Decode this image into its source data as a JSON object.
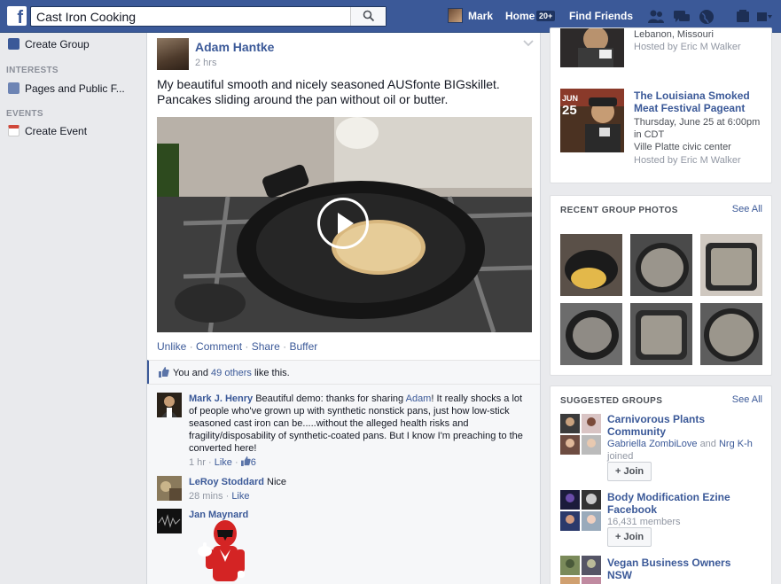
{
  "topbar": {
    "search_value": "Cast Iron Cooking",
    "user_name": "Mark",
    "home_label": "Home",
    "home_badge": "20+",
    "find_friends": "Find Friends",
    "bg_color": "#3b5998"
  },
  "left": {
    "create_group": "Create Group",
    "interests_head": "INTERESTS",
    "pages_feeds": "Pages and Public F...",
    "events_head": "EVENTS",
    "create_event": "Create Event"
  },
  "post": {
    "author": "Adam Hantke",
    "time": "2 hrs",
    "text": "My beautiful smooth and nicely seasoned AUSfonte BIGskillet. Pancakes sliding around the pan without oil or butter.",
    "actions": {
      "unlike": "Unlike",
      "comment": "Comment",
      "share": "Share",
      "buffer": "Buffer",
      "sep": "·"
    },
    "likes": {
      "you_and": "You and",
      "others": "49 others",
      "like_this": "like this."
    },
    "comments": [
      {
        "name": "Mark J. Henry",
        "text_a": "Beautiful demo: thanks for sharing",
        "mention": "Adam",
        "text_b": "! It really shocks a lot of people who've grown up with synthetic nonstick pans, just how low-stick seasoned cast iron can be.....without the alleged health risks and fragility/disposability of synthetic-coated pans. But I know I'm preaching to the converted here!",
        "time": "1 hr",
        "like": "Like",
        "like_count": "6"
      },
      {
        "name": "LeRoy Stoddard",
        "text": "Nice",
        "time": "28 mins",
        "like": "Like"
      },
      {
        "name": "Jan Maynard"
      }
    ]
  },
  "events": [
    {
      "location_tail": "Lebanon, Missouri",
      "host": "Hosted by Eric M Walker"
    },
    {
      "month": "JUN",
      "day": "25",
      "title": "The Louisiana Smoked Meat Festival Pageant",
      "when": "Thursday, June 25 at 6:00pm in CDT",
      "where": "Ville Platte civic center",
      "host": "Hosted by Eric M Walker"
    }
  ],
  "recent_photos": {
    "heading": "RECENT GROUP PHOTOS",
    "see_all": "See All"
  },
  "suggested": {
    "heading": "SUGGESTED GROUPS",
    "see_all": "See All",
    "groups": [
      {
        "name": "Carnivorous Plants Community",
        "member_a": "Gabriella ZombiLove",
        "and": "and",
        "member_b": "Nrg K-h",
        "joined": "joined",
        "join": "Join"
      },
      {
        "name": "Body Modification Ezine Facebook",
        "members": "16,431 members",
        "join": "Join"
      },
      {
        "name": "Vegan Business Owners NSW"
      }
    ]
  }
}
